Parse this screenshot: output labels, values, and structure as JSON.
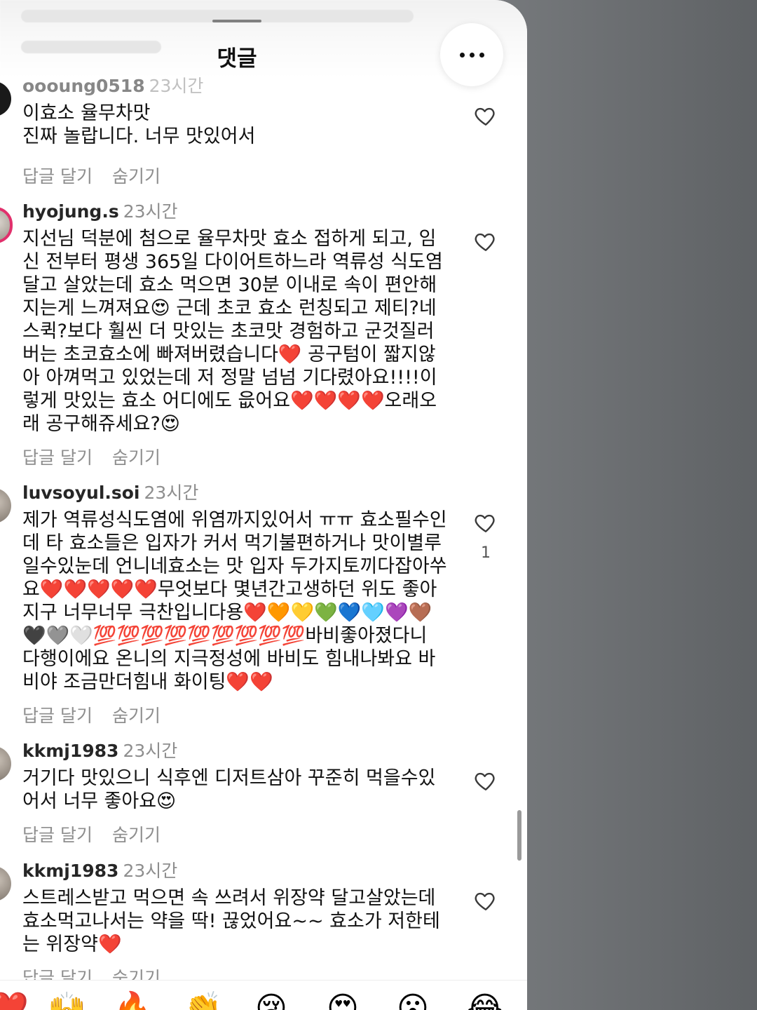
{
  "header": {
    "title": "댓글",
    "more_label": "더보기"
  },
  "comments": [
    {
      "username": "oooung0518",
      "time": "23시간",
      "text": "이효소 율무차맛\n진짜 놀랍니다. 너무 맛있어서",
      "reply_label": "답글 달기",
      "hide_label": "숨기기",
      "likes": ""
    },
    {
      "username": "hyojung.s",
      "time": "23시간",
      "text": "지선님 덕분에 첨으로 율무차맛 효소 접하게 되고, 임신 전부터 평생 365일 다이어트하느라 역류성 식도염달고 살았는데 효소 먹으면 30분 이내로 속이 편안해지는게 느껴져요😍 근데 초코 효소 런칭되고 제티?네스퀵?보다 훨씬 더 맛있는 초코맛 경험하고 군것질러버는 초코효소에 빠져버렸습니다❤️ 공구텀이 짧지않아 아껴먹고 있었는데 저 정말 넘넘 기다렸아요!!!!이렇게 맛있는 효소 어디에도 읎어요❤️❤️❤️❤️오래오래 공구해쥬세요?😍",
      "reply_label": "답글 달기",
      "hide_label": "숨기기",
      "likes": ""
    },
    {
      "username": "luvsoyul.soi",
      "time": "23시간",
      "text": "제가 역류성식도염에 위염까지있어서 ㅠㅠ 효소필수인데 타 효소들은 입자가 커서 먹기불편하거나 맛이별루일수있눈데 언니네효소는 맛 입자 두가지토끼다잡아쑤요❤️❤️❤️❤️❤️무엇보다 몇년간고생하던 위도 좋아지구 너무너무 극찬입니다용❤️🧡💛💚💙🩵💜🤎🖤🩶🤍💯💯💯💯💯💯💯💯💯바비좋아졌다니 다행이에요 온니의 지극정성에 바비도 힘내나봐요 바비야 조금만더힘내 화이팅❤️❤️",
      "reply_label": "답글 달기",
      "hide_label": "숨기기",
      "likes": "1"
    },
    {
      "username": "kkmj1983",
      "time": "23시간",
      "text": "거기다 맛있으니 식후엔 디저트삼아 꾸준히 먹을수있어서 너무 좋아요😍",
      "reply_label": "답글 달기",
      "hide_label": "숨기기",
      "likes": ""
    },
    {
      "username": "kkmj1983",
      "time": "23시간",
      "text": "스트레스받고 먹으면 속 쓰려서 위장약 달고살았는데 효소먹고나서는 약을 딱! 끊었어요~~ 효소가 저한테는 위장약❤️",
      "reply_label": "답글 달기",
      "hide_label": "숨기기",
      "likes": ""
    }
  ],
  "reactions": [
    "❤️",
    "🙌",
    "🔥",
    "👏",
    "😢",
    "😍",
    "😮",
    "😂"
  ],
  "colors": {
    "background": "#ffffff",
    "text": "#111111",
    "secondary_text": "#8e8e8e",
    "heart": "#e0102d"
  }
}
